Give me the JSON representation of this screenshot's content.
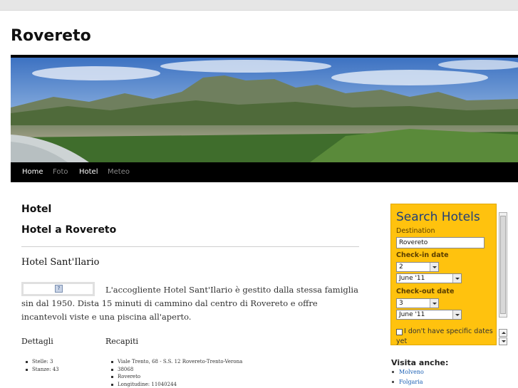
{
  "site": {
    "title": "Rovereto"
  },
  "nav": {
    "items": [
      "Home",
      "Foto",
      "Hotel",
      "Meteo"
    ],
    "active": "Hotel"
  },
  "main": {
    "heading": "Hotel",
    "subheading": "Hotel a Rovereto",
    "hotel_name": "Hotel Sant'Ilario",
    "image_placeholder": "?",
    "description": "L'accogliente Hotel Sant'Ilario è gestito dalla stessa famiglia sin dal 1950. Dista 15 minuti di cammino dal centro di Rovereto e offre incantevoli viste e una piscina all'aperto.",
    "details_title": "Dettagli",
    "details": [
      "Stelle: 3",
      "Stanze: 43"
    ],
    "contacts_title": "Recapiti",
    "contacts": [
      "Viale Trento, 68 - S.S. 12 Rovereto-Trento-Verona",
      "38068",
      "Rovereto",
      "Longitudine: 11040244"
    ]
  },
  "search": {
    "title": "Search Hotels",
    "destination_label": "Destination",
    "destination_value": "Rovereto",
    "checkin_label": "Check-in date",
    "checkin_day": "2",
    "checkin_month": "June '11",
    "checkout_label": "Check-out date",
    "checkout_day": "3",
    "checkout_month": "June '11",
    "no_dates_label": "I don't have specific dates yet"
  },
  "visita": {
    "title": "Visita anche:",
    "items": [
      "Molveno",
      "Folgaria"
    ]
  },
  "colors": {
    "search_bg": "#ffc20e",
    "nav_bg": "#000000",
    "link": "#1a5fb4",
    "search_title": "#1f3f7a"
  }
}
